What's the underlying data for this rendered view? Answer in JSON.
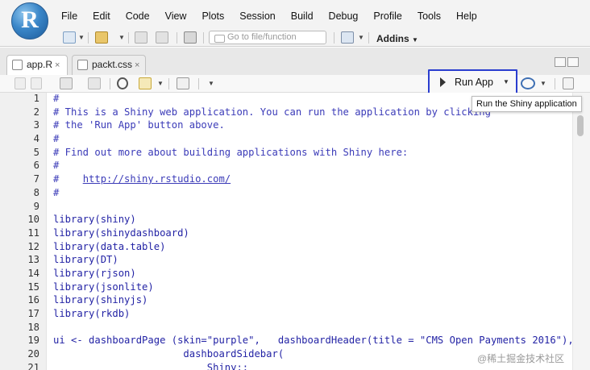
{
  "app": {
    "logo_letter": "R"
  },
  "menu": [
    "File",
    "Edit",
    "Code",
    "View",
    "Plots",
    "Session",
    "Build",
    "Debug",
    "Profile",
    "Tools",
    "Help"
  ],
  "toolbar": {
    "goto_placeholder": "Go to file/function",
    "addins_label": "Addins"
  },
  "tabs": [
    {
      "label": "app.R",
      "close": "×",
      "active": true
    },
    {
      "label": "packt.css",
      "close": "×",
      "active": false
    }
  ],
  "editor_toolbar": {
    "run_app_label": "Run App",
    "tooltip": "Run the Shiny application"
  },
  "code_lines": [
    {
      "n": "1",
      "text": "#",
      "kind": "comment"
    },
    {
      "n": "2",
      "text": "# This is a Shiny web application. You can run the application by clicking",
      "kind": "comment"
    },
    {
      "n": "3",
      "text": "# the 'Run App' button above.",
      "kind": "comment"
    },
    {
      "n": "4",
      "text": "#",
      "kind": "comment"
    },
    {
      "n": "5",
      "text": "# Find out more about building applications with Shiny here:",
      "kind": "comment"
    },
    {
      "n": "6",
      "text": "#",
      "kind": "comment"
    },
    {
      "n": "7",
      "text": "#    http://shiny.rstudio.com/",
      "kind": "url"
    },
    {
      "n": "8",
      "text": "#",
      "kind": "comment"
    },
    {
      "n": "9",
      "text": "",
      "kind": "plain"
    },
    {
      "n": "10",
      "text": "library(shiny)",
      "kind": "kw"
    },
    {
      "n": "11",
      "text": "library(shinydashboard)",
      "kind": "kw"
    },
    {
      "n": "12",
      "text": "library(data.table)",
      "kind": "kw"
    },
    {
      "n": "13",
      "text": "library(DT)",
      "kind": "kw"
    },
    {
      "n": "14",
      "text": "library(rjson)",
      "kind": "kw"
    },
    {
      "n": "15",
      "text": "library(jsonlite)",
      "kind": "kw"
    },
    {
      "n": "16",
      "text": "library(shinyjs)",
      "kind": "kw"
    },
    {
      "n": "17",
      "text": "library(rkdb)",
      "kind": "kw"
    },
    {
      "n": "18",
      "text": "",
      "kind": "plain"
    },
    {
      "n": "19",
      "text": "ui <- dashboardPage (skin=\"purple\",   dashboardHeader(title = \"CMS Open Payments 2016\"),",
      "kind": "kw"
    },
    {
      "n": "20",
      "text": "                      dashboardSidebar(",
      "kind": "kw"
    },
    {
      "n": "21",
      "text": "                          Shiny::",
      "kind": "kw"
    }
  ],
  "watermark": "@稀土掘金技术社区"
}
